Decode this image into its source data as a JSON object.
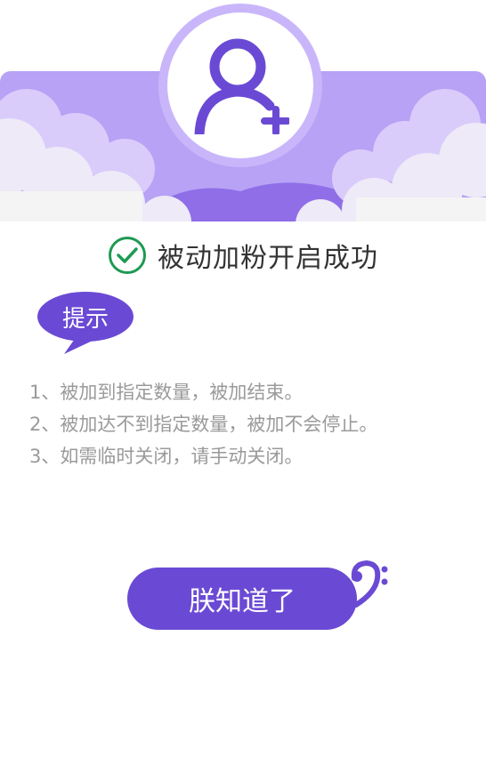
{
  "dialog": {
    "title": "被动加粉开启成功",
    "tip_label": "提示",
    "tips": [
      "1、被加到指定数量，被加结束。",
      "2、被加达不到指定数量，被加不会停止。",
      "3、如需临时关闭，请手动关闭。"
    ],
    "confirm_label": "朕知道了"
  },
  "icons": {
    "header": "add-user-icon",
    "title": "check-circle-icon",
    "decoration": "bass-clef-icon"
  },
  "colors": {
    "accent": "#6a4ad4",
    "header_bg": "#b7a2f5",
    "success": "#1e9a52",
    "tip_text": "#9a9a9a"
  }
}
